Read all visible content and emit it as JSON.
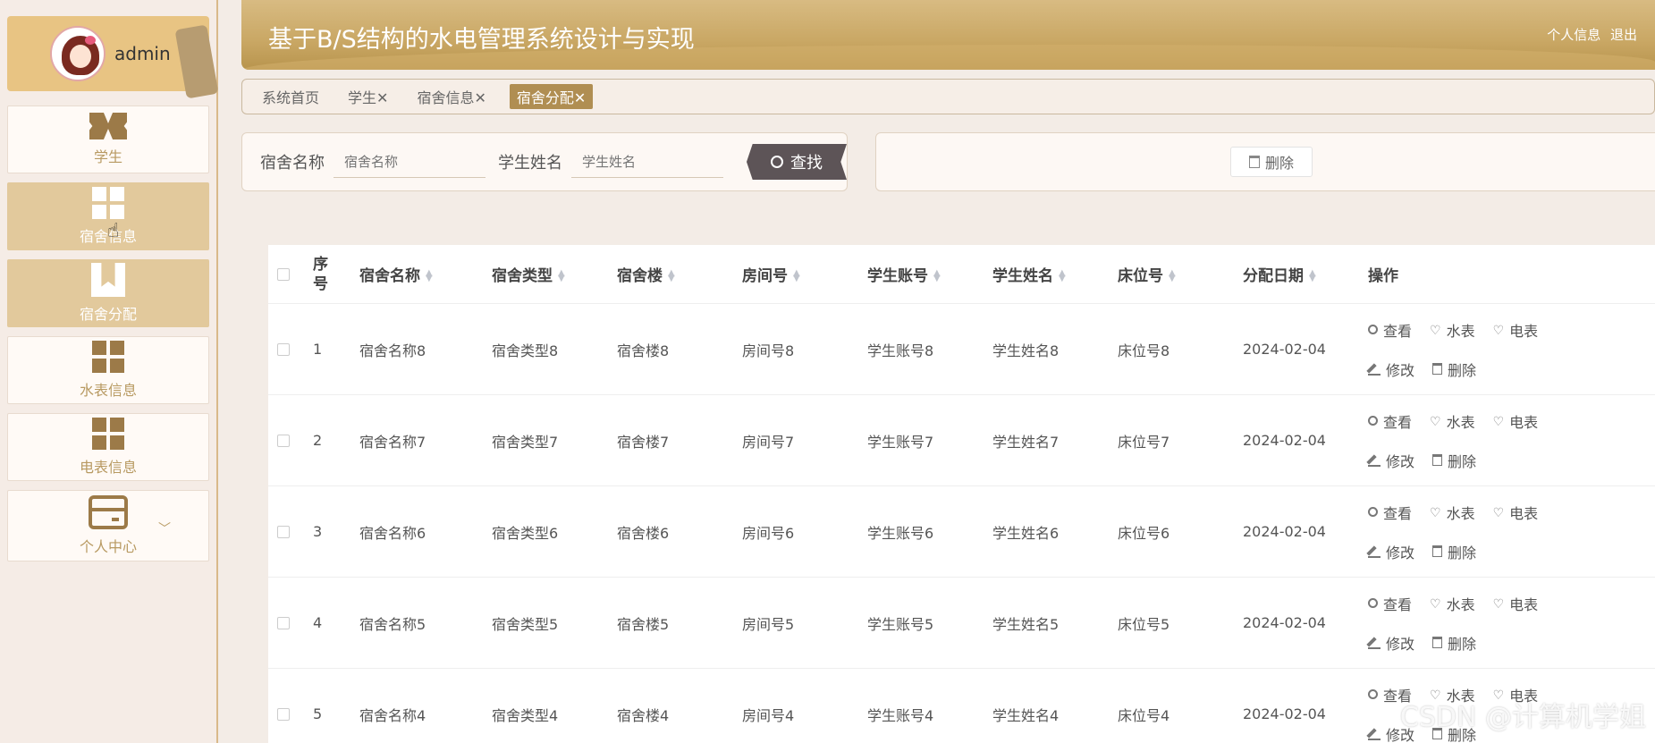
{
  "user": {
    "name": "admin"
  },
  "sidebar": {
    "items": [
      {
        "label": "学生",
        "icon": "ticket-icon"
      },
      {
        "label": "宿舍信息",
        "icon": "grid-icon"
      },
      {
        "label": "宿舍分配",
        "icon": "book-icon"
      },
      {
        "label": "水表信息",
        "icon": "grid-icon"
      },
      {
        "label": "电表信息",
        "icon": "grid-icon"
      },
      {
        "label": "个人中心",
        "icon": "card-icon"
      }
    ]
  },
  "header": {
    "title": "基于B/S结构的水电管理系统设计与实现",
    "profile_link": "个人信息",
    "logout_link": "退出"
  },
  "tabs": [
    {
      "label": "系统首页"
    },
    {
      "label": "学生✕"
    },
    {
      "label": "宿舍信息✕"
    },
    {
      "label": "宿舍分配✕"
    }
  ],
  "search": {
    "dorm_label": "宿舍名称",
    "dorm_placeholder": "宿舍名称",
    "student_label": "学生姓名",
    "student_placeholder": "学生姓名",
    "button_label": "查找"
  },
  "actions": {
    "delete_label": "删除"
  },
  "table": {
    "columns": {
      "idx": "序\n号",
      "name": "宿舍名称",
      "type": "宿舍类型",
      "building": "宿舍楼",
      "room": "房间号",
      "account": "学生账号",
      "student": "学生姓名",
      "bed": "床位号",
      "date": "分配日期",
      "ops": "操作"
    },
    "ops": {
      "view": "查看",
      "water": "水表",
      "electric": "电表",
      "edit": "修改",
      "delete": "删除"
    },
    "rows": [
      {
        "idx": "1",
        "name": "宿舍名称8",
        "type": "宿舍类型8",
        "building": "宿舍楼8",
        "room": "房间号8",
        "account": "学生账号8",
        "student": "学生姓名8",
        "bed": "床位号8",
        "date": "2024-02-04"
      },
      {
        "idx": "2",
        "name": "宿舍名称7",
        "type": "宿舍类型7",
        "building": "宿舍楼7",
        "room": "房间号7",
        "account": "学生账号7",
        "student": "学生姓名7",
        "bed": "床位号7",
        "date": "2024-02-04"
      },
      {
        "idx": "3",
        "name": "宿舍名称6",
        "type": "宿舍类型6",
        "building": "宿舍楼6",
        "room": "房间号6",
        "account": "学生账号6",
        "student": "学生姓名6",
        "bed": "床位号6",
        "date": "2024-02-04"
      },
      {
        "idx": "4",
        "name": "宿舍名称5",
        "type": "宿舍类型5",
        "building": "宿舍楼5",
        "room": "房间号5",
        "account": "学生账号5",
        "student": "学生姓名5",
        "bed": "床位号5",
        "date": "2024-02-04"
      },
      {
        "idx": "5",
        "name": "宿舍名称4",
        "type": "宿舍类型4",
        "building": "宿舍楼4",
        "room": "房间号4",
        "account": "学生账号4",
        "student": "学生姓名4",
        "bed": "床位号4",
        "date": "2024-02-04"
      }
    ]
  },
  "watermark": "CSDN @计算机学姐",
  "colors": {
    "accent": "#b08e52",
    "header": "#c9a764",
    "sidebar_active": "#e2c99c",
    "search_button": "#5d5457"
  }
}
